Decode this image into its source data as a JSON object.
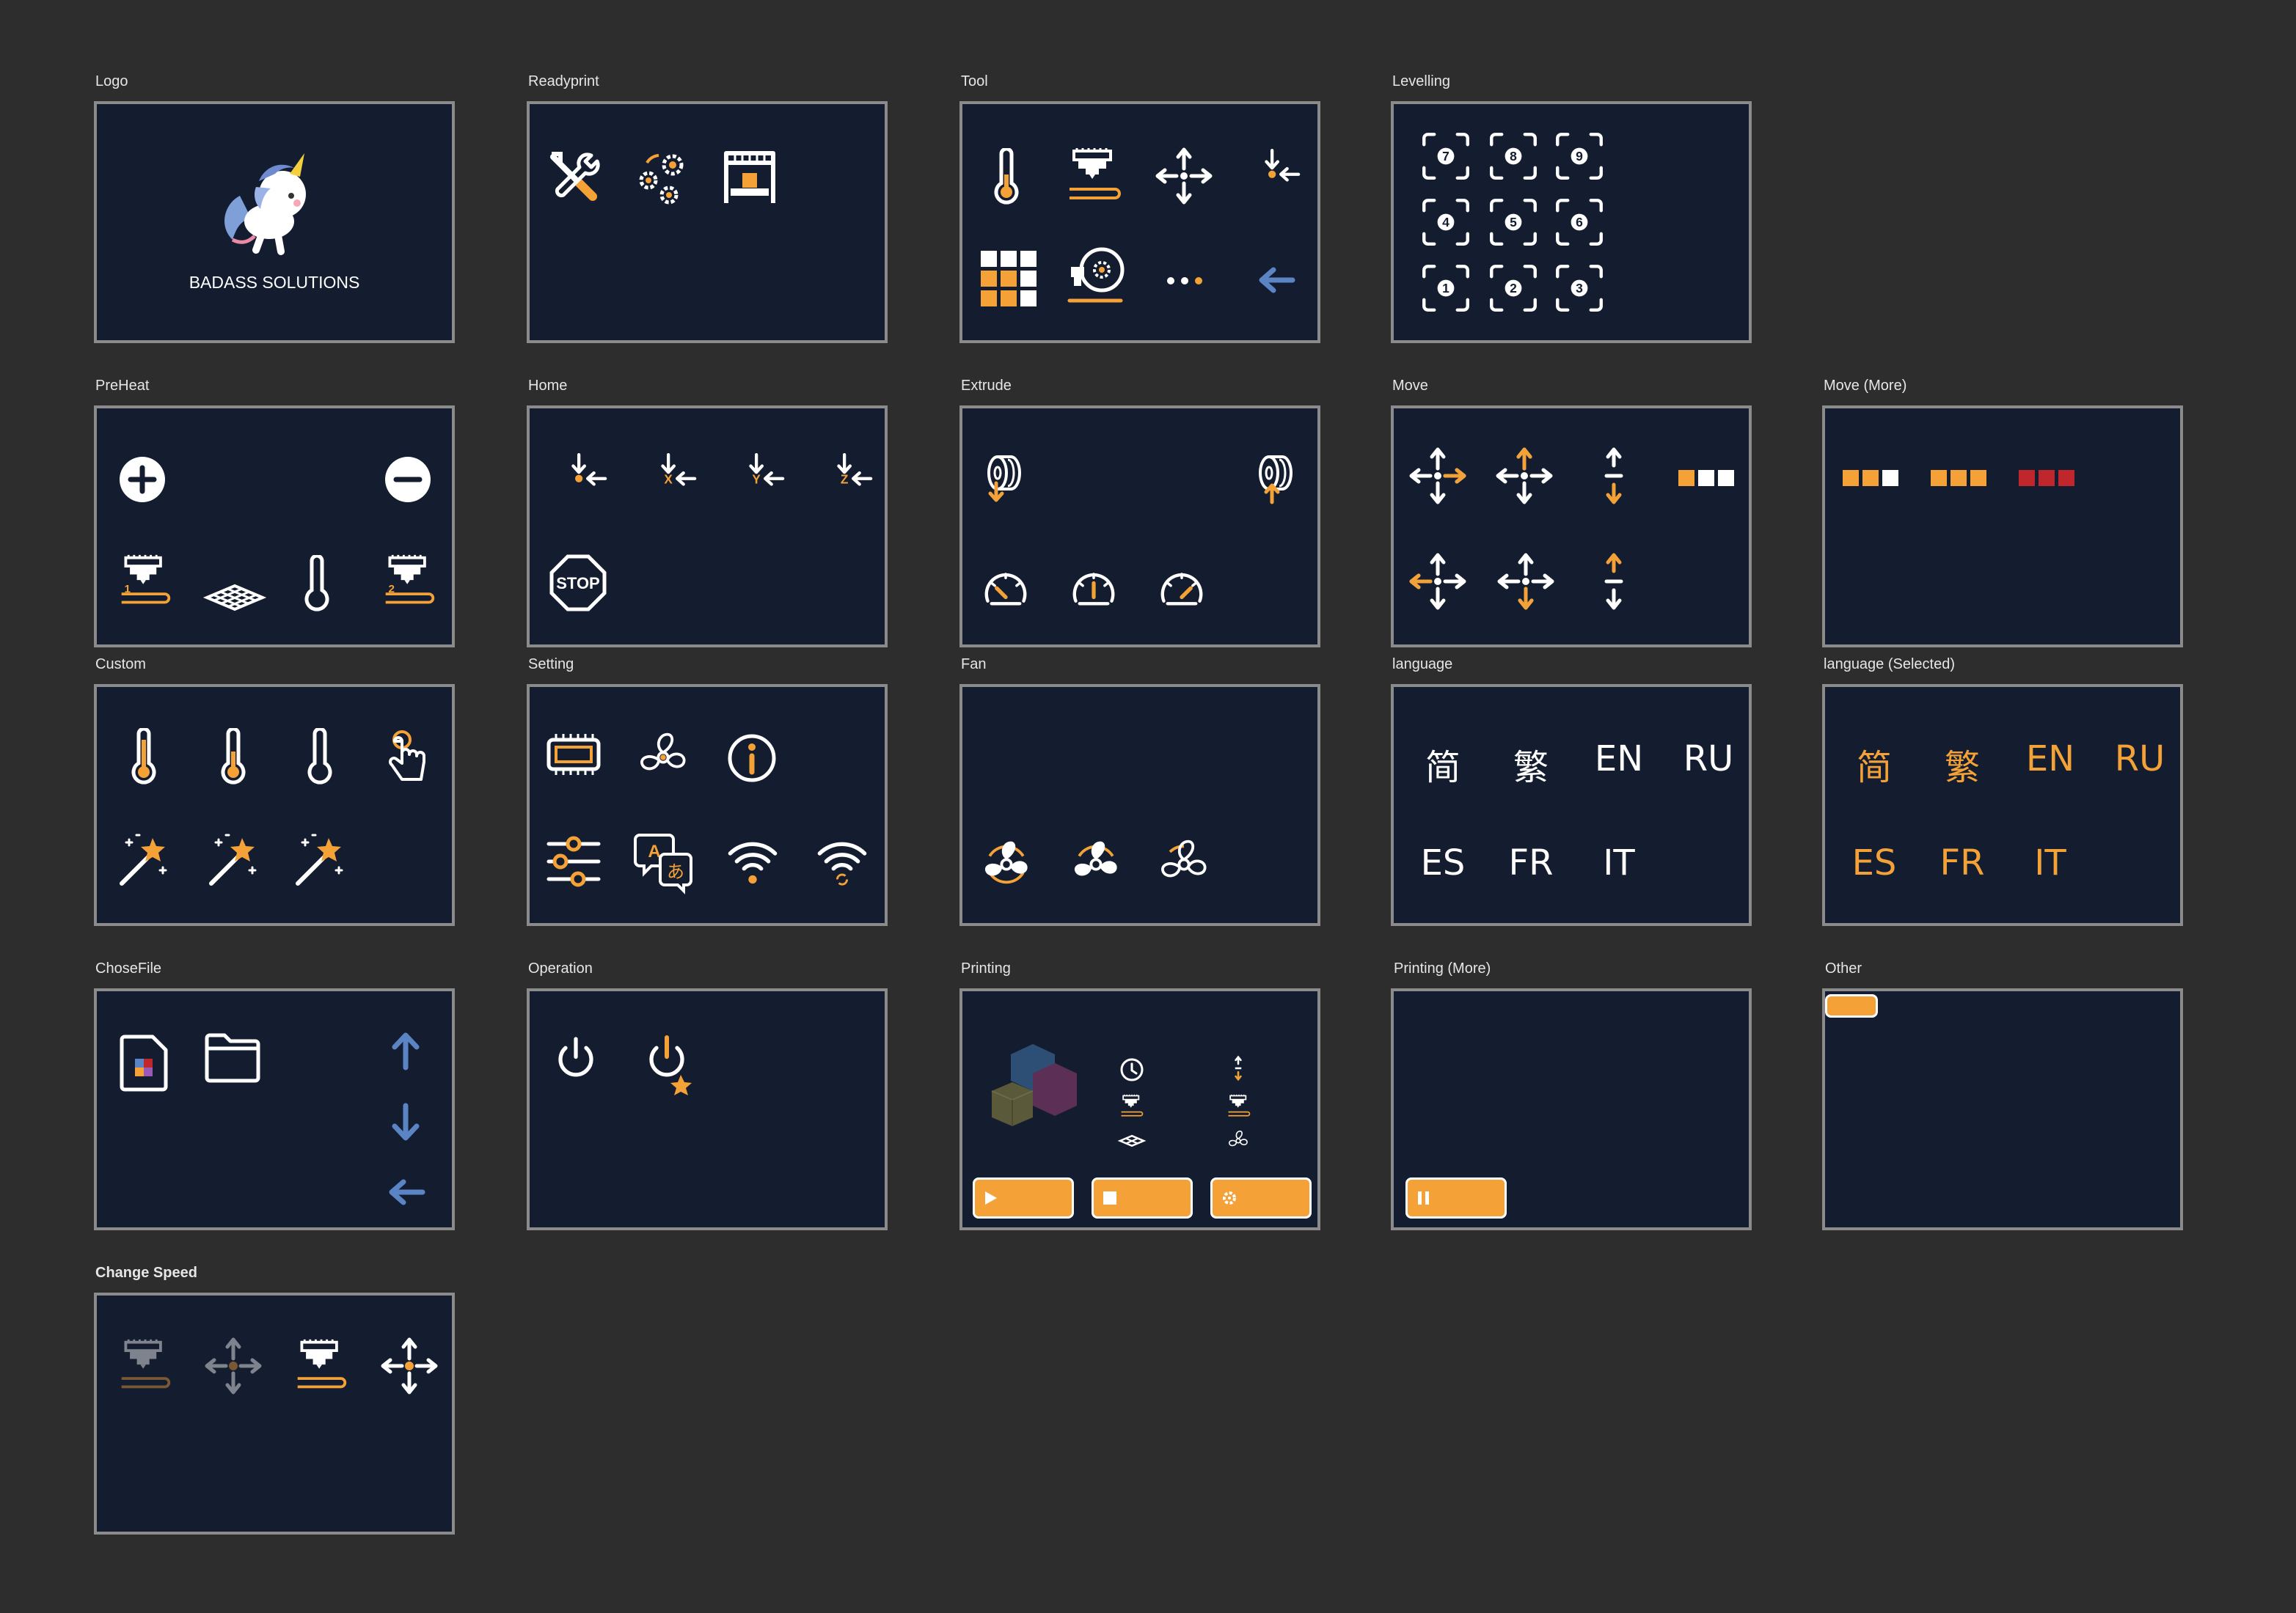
{
  "colors": {
    "background": "#2d2d2d",
    "panel": "#141d2f",
    "panel_border": "#8b8b8b",
    "accent": "#f4a238",
    "blue": "#5b84c4",
    "red": "#c0272d",
    "white": "#ffffff"
  },
  "sections": {
    "logo": {
      "label": "Logo",
      "brand_text": "BADASS SOLUTIONS"
    },
    "readyprint": {
      "label": "Readyprint"
    },
    "tool": {
      "label": "Tool"
    },
    "levelling": {
      "label": "Levelling",
      "points": [
        "7",
        "8",
        "9",
        "4",
        "5",
        "6",
        "1",
        "2",
        "3"
      ]
    },
    "preheat": {
      "label": "PreHeat",
      "nozzle1": "1",
      "nozzle2": "2"
    },
    "home": {
      "label": "Home",
      "axis_x": "X",
      "axis_y": "Y",
      "axis_z": "Z",
      "stop": "STOP"
    },
    "extrude": {
      "label": "Extrude"
    },
    "move": {
      "label": "Move"
    },
    "move_more": {
      "label": "Move (More)"
    },
    "custom": {
      "label": "Custom"
    },
    "setting": {
      "label": "Setting",
      "lang_glyph_a": "A",
      "lang_glyph_b": "あ"
    },
    "fan": {
      "label": "Fan"
    },
    "language": {
      "label": "language",
      "items": [
        "简",
        "繁",
        "EN",
        "RU",
        "ES",
        "FR",
        "IT"
      ]
    },
    "language_selected": {
      "label": "language (Selected)",
      "items": [
        "简",
        "繁",
        "EN",
        "RU",
        "ES",
        "FR",
        "IT"
      ]
    },
    "chosefile": {
      "label": "ChoseFile"
    },
    "operation": {
      "label": "Operation"
    },
    "printing": {
      "label": "Printing"
    },
    "printing_more": {
      "label": "Printing (More)"
    },
    "other": {
      "label": "Other"
    },
    "change_speed": {
      "label": "Change Speed"
    }
  }
}
